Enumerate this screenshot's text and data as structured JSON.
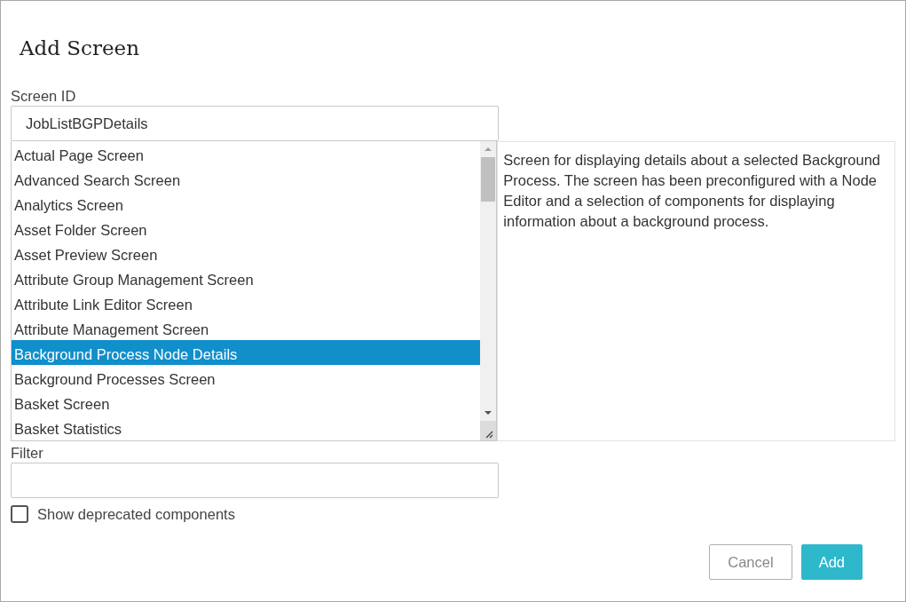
{
  "dialog": {
    "title": "Add Screen"
  },
  "screen_id": {
    "label": "Screen ID",
    "value": "JobListBGPDetails"
  },
  "screen_list": [
    {
      "label": "Actual Page Screen",
      "selected": false
    },
    {
      "label": "Advanced Search Screen",
      "selected": false
    },
    {
      "label": "Analytics Screen",
      "selected": false
    },
    {
      "label": "Asset Folder Screen",
      "selected": false
    },
    {
      "label": "Asset Preview Screen",
      "selected": false
    },
    {
      "label": "Attribute Group Management Screen",
      "selected": false
    },
    {
      "label": "Attribute Link Editor Screen",
      "selected": false
    },
    {
      "label": "Attribute Management Screen",
      "selected": false
    },
    {
      "label": "Background Process Node Details",
      "selected": true
    },
    {
      "label": "Background Processes Screen",
      "selected": false
    },
    {
      "label": "Basket Screen",
      "selected": false
    },
    {
      "label": "Basket Statistics",
      "selected": false
    }
  ],
  "description": "Screen for displaying details about a selected Background Process. The screen has been preconfigured with a Node Editor and a selection of components for displaying information about a background process.",
  "filter": {
    "label": "Filter"
  },
  "show_deprecated": {
    "label": "Show deprecated components",
    "checked": false
  },
  "buttons": [
    {
      "label": "Cancel",
      "kind": "secondary"
    },
    {
      "label": "Add",
      "kind": "primary"
    }
  ]
}
